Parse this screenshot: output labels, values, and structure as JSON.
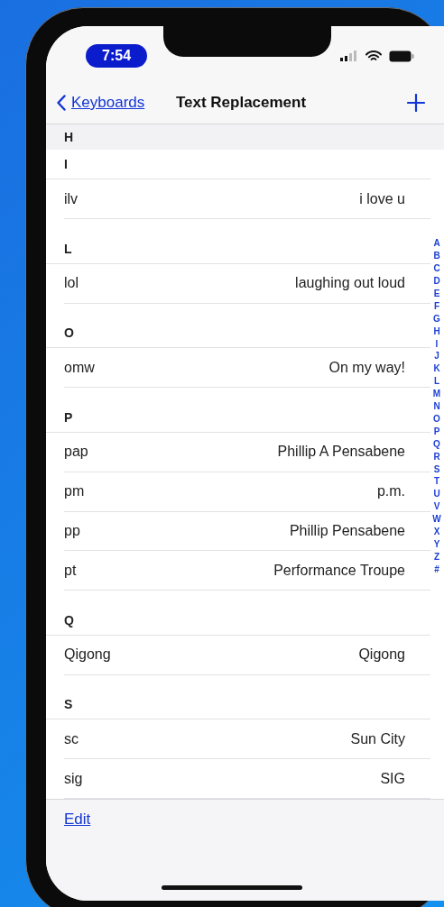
{
  "status_bar": {
    "time": "7:54"
  },
  "nav": {
    "back": "Keyboards",
    "title": "Text Replacement"
  },
  "sticky_header": "H",
  "sections": [
    {
      "letter": "I",
      "rows": [
        {
          "phrase": "i love u",
          "shortcut": "ilv"
        }
      ]
    },
    {
      "letter": "L",
      "rows": [
        {
          "phrase": "laughing out loud",
          "shortcut": "lol"
        }
      ]
    },
    {
      "letter": "O",
      "rows": [
        {
          "phrase": "On my way!",
          "shortcut": "omw"
        }
      ]
    },
    {
      "letter": "P",
      "rows": [
        {
          "phrase": "Phillip A Pensabene",
          "shortcut": "pap"
        },
        {
          "phrase": "p.m.",
          "shortcut": "pm"
        },
        {
          "phrase": "Phillip Pensabene",
          "shortcut": "pp"
        },
        {
          "phrase": "Performance Troupe",
          "shortcut": "pt"
        }
      ]
    },
    {
      "letter": "Q",
      "rows": [
        {
          "phrase": "Qigong",
          "shortcut": "Qigong"
        }
      ]
    },
    {
      "letter": "S",
      "rows": [
        {
          "phrase": "Sun City",
          "shortcut": "sc"
        },
        {
          "phrase": "SIG",
          "shortcut": "sig"
        }
      ]
    }
  ],
  "index": [
    "A",
    "B",
    "C",
    "D",
    "E",
    "F",
    "G",
    "H",
    "I",
    "J",
    "K",
    "L",
    "M",
    "N",
    "O",
    "P",
    "Q",
    "R",
    "S",
    "T",
    "U",
    "V",
    "W",
    "X",
    "Y",
    "Z",
    "#"
  ],
  "toolbar": {
    "edit": "Edit"
  }
}
